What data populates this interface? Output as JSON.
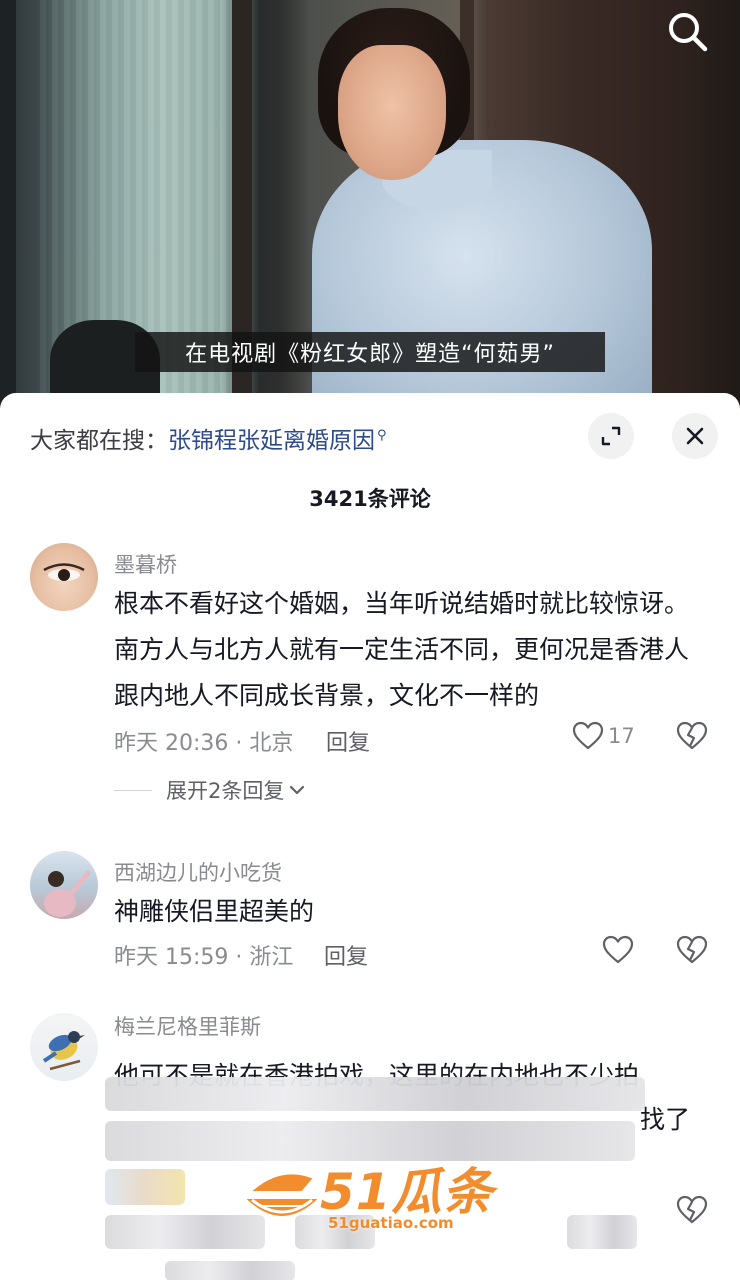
{
  "video": {
    "subtitle": "在电视剧《粉红女郎》塑造“何茹男”",
    "search_icon": "search-icon"
  },
  "sheet": {
    "hot_search_prefix": "大家都在搜：",
    "hot_search_link": "张锦程张延离婚原因",
    "comment_count": "3421条评论",
    "expand_icon": "expand-icon",
    "close_icon": "close-icon"
  },
  "comments": [
    {
      "username": "墨暮桥",
      "text": "根本不看好这个婚姻，当年听说结婚时就比较惊讶。南方人与北方人就有一定生活不同，更何况是香港人跟内地人不同成长背景，文化不一样的",
      "time_location": "昨天 20:36 · 北京",
      "reply": "回复",
      "likes": "17",
      "expand_replies": "展开2条回复"
    },
    {
      "username": "西湖边儿的小吃货",
      "text": "神雕侠侣里超美的",
      "time_location": "昨天 15:59 · 浙江",
      "reply": "回复"
    },
    {
      "username": "梅兰尼格里菲斯",
      "text_line1": "他可不是就在香港拍戏，这里的在内地也不少拍",
      "text_tail": "找了"
    }
  ],
  "watermark": {
    "brand": "51瓜条",
    "domain": "51guatiao.com"
  }
}
